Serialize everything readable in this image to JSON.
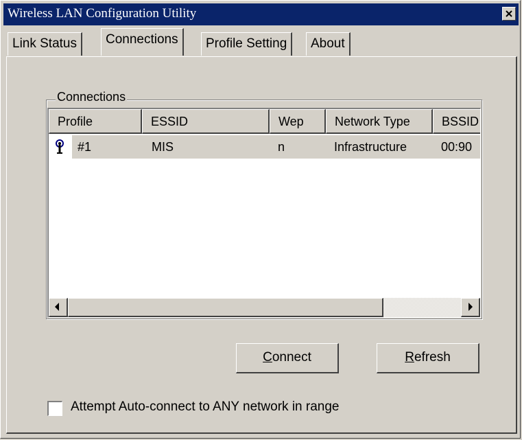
{
  "window": {
    "title": "Wireless LAN Configuration Utility",
    "close_icon": "close-x-icon"
  },
  "tabs": [
    {
      "label": "Link Status",
      "active": false
    },
    {
      "label": "Connections",
      "active": true
    },
    {
      "label": "Profile Setting",
      "active": false
    },
    {
      "label": "About",
      "active": false
    }
  ],
  "connections": {
    "group_label": "Connections",
    "columns": [
      "Profile",
      "ESSID",
      "Wep",
      "Network Type",
      "BSSID"
    ],
    "rows": [
      {
        "icon": "wireless-antenna-icon",
        "profile": "#1",
        "essid": "MIS",
        "wep": "n",
        "network_type": "Infrastructure",
        "bssid": "00:90"
      }
    ]
  },
  "buttons": {
    "connect": {
      "mnemonic": "C",
      "rest": "onnect"
    },
    "refresh": {
      "mnemonic": "R",
      "rest": "efresh"
    }
  },
  "auto_connect": {
    "label": "Attempt Auto-connect to ANY network in range",
    "checked": false
  },
  "colors": {
    "titlebar": "#0a246a",
    "face": "#d4d0c8",
    "selected_row": "#d4d0c8"
  }
}
